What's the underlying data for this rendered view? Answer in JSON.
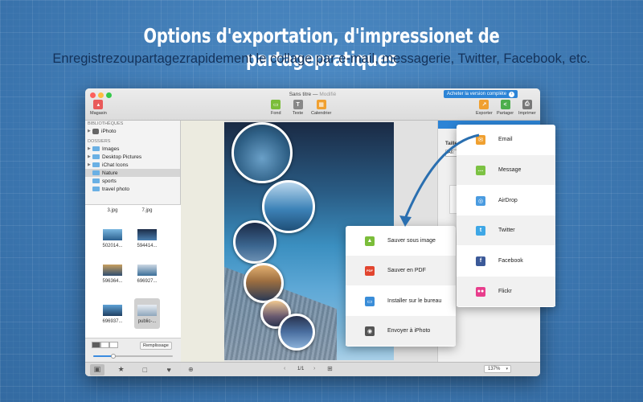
{
  "banner": {
    "headline": "Options d'exportation, d'impressionet de partagepratiques",
    "subline": "Enregistrezoupartagezrapidement le collage par e-mail, messagerie, Twitter, Facebook, etc."
  },
  "window": {
    "title": "Sans titre",
    "separator": "—",
    "modified": "Modifié",
    "buy_label": "Acheter la version complète"
  },
  "toolbar": {
    "magasin": "Magasin",
    "fond": "Fond",
    "texte": "Texte",
    "calendrier": "Calendrier",
    "exporter": "Exporter",
    "partager": "Partager",
    "imprimer": "Imprimer"
  },
  "sidebar": {
    "library_header": "BIBLIOTHÈQUES",
    "library_items": [
      "iPhoto"
    ],
    "folders_header": "DOSSIERS",
    "folders": [
      "Images",
      "Desktop Pictures",
      "iChat Icons",
      "Nature",
      "sports",
      "travel photo"
    ],
    "selected_folder": "Nature"
  },
  "thumbnails": [
    {
      "label": "3.jpg"
    },
    {
      "label": "7.jpg"
    },
    {
      "label": "502014..."
    },
    {
      "label": "594414..."
    },
    {
      "label": "596364..."
    },
    {
      "label": "696927..."
    },
    {
      "label": "696937..."
    },
    {
      "label": "public-..."
    }
  ],
  "sidebar_bottom": {
    "remplissage": "Remplissage",
    "slider_fraction": 0.25
  },
  "statusbar": {
    "page": "1/1",
    "zoom": "137%"
  },
  "right_panel": {
    "taille_label": "Taille",
    "size_value": "A6:"
  },
  "export_menu": [
    {
      "label": "Sauver sous image",
      "icon": "image-icon",
      "color": "#7bbd3a"
    },
    {
      "label": "Sauver en PDF",
      "icon": "pdf-icon",
      "color": "#e2452f"
    },
    {
      "label": "Installer sur le bureau",
      "icon": "desktop-icon",
      "color": "#3a8dd8"
    },
    {
      "label": "Envoyer à iPhoto",
      "icon": "camera-icon",
      "color": "#555555"
    }
  ],
  "share_menu": [
    {
      "label": "Email",
      "icon": "mail-icon",
      "color": "#f0a030"
    },
    {
      "label": "Message",
      "icon": "message-icon",
      "color": "#7cc243"
    },
    {
      "label": "AirDrop",
      "icon": "airdrop-icon",
      "color": "#4a9be0"
    },
    {
      "label": "Twitter",
      "icon": "twitter-icon",
      "color": "#3ea7e6"
    },
    {
      "label": "Facebook",
      "icon": "facebook-icon",
      "color": "#3b5998"
    },
    {
      "label": "Flickr",
      "icon": "flickr-icon",
      "color": "#e83e8c"
    }
  ]
}
